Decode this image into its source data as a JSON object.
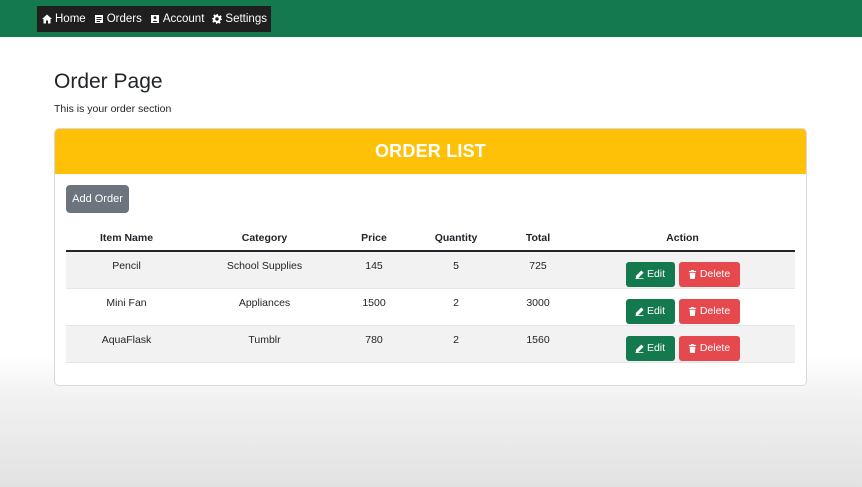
{
  "nav": {
    "items": [
      {
        "label": "Home",
        "icon": "home-icon"
      },
      {
        "label": "Orders",
        "icon": "orders-icon"
      },
      {
        "label": "Account",
        "icon": "account-icon"
      },
      {
        "label": "Settings",
        "icon": "gear-icon"
      }
    ]
  },
  "page": {
    "title": "Order Page",
    "subtitle": "This is your order section"
  },
  "card": {
    "header": "ORDER LIST",
    "add_label": "Add Order"
  },
  "table": {
    "columns": [
      "Item Name",
      "Category",
      "Price",
      "Quantity",
      "Total",
      "Action"
    ],
    "rows": [
      {
        "name": "Pencil",
        "category": "School Supplies",
        "price": "145",
        "quantity": "5",
        "total": "725"
      },
      {
        "name": "Mini Fan",
        "category": "Appliances",
        "price": "1500",
        "quantity": "2",
        "total": "3000"
      },
      {
        "name": "AquaFlask",
        "category": "Tumblr",
        "price": "780",
        "quantity": "2",
        "total": "1560"
      }
    ],
    "edit_label": "Edit",
    "delete_label": "Delete"
  },
  "colors": {
    "navbar": "#147a4d",
    "header": "#ffc107",
    "edit": "#147a4d",
    "delete": "#e5484d",
    "add": "#6c757d"
  }
}
